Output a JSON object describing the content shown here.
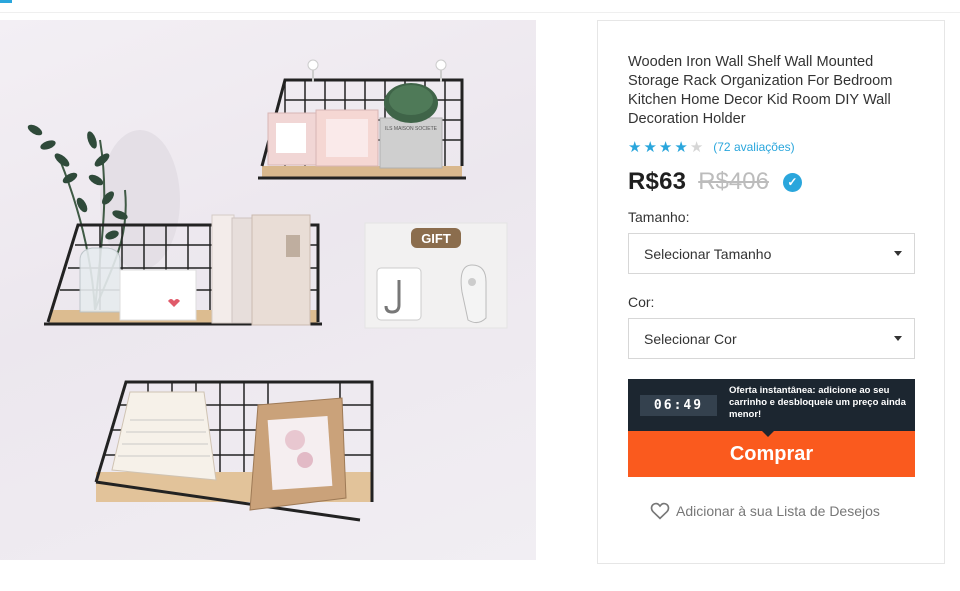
{
  "product": {
    "title": "Wooden Iron Wall Shelf Wall Mounted Storage Rack Organization For Bedroom Kitchen Home Decor Kid Room DIY Wall Decoration Holder",
    "rating": 4,
    "rating_max": 5,
    "reviews_label": "(72 avaliações)",
    "price": "R$63",
    "old_price": "R$406"
  },
  "gallery": {
    "gift_label": "GIFT",
    "box_label": "ILS MAISON SOCIETE",
    "pot_label": "ILS MAISON SOCIETE"
  },
  "options": {
    "size_label": "Tamanho:",
    "size_value": "Selecionar Tamanho",
    "color_label": "Cor:",
    "color_value": "Selecionar Cor"
  },
  "offer": {
    "timer": "06:49",
    "text": "Oferta instantânea: adicione ao seu carrinho e desbloqueie um preço ainda menor!"
  },
  "actions": {
    "buy_label": "Comprar",
    "wishlist_label": "Adicionar à sua Lista de Desejos"
  },
  "colors": {
    "accent": "#2aa6dc",
    "buy_button": "#fa5a1e",
    "offer_bg": "#1c2630"
  }
}
